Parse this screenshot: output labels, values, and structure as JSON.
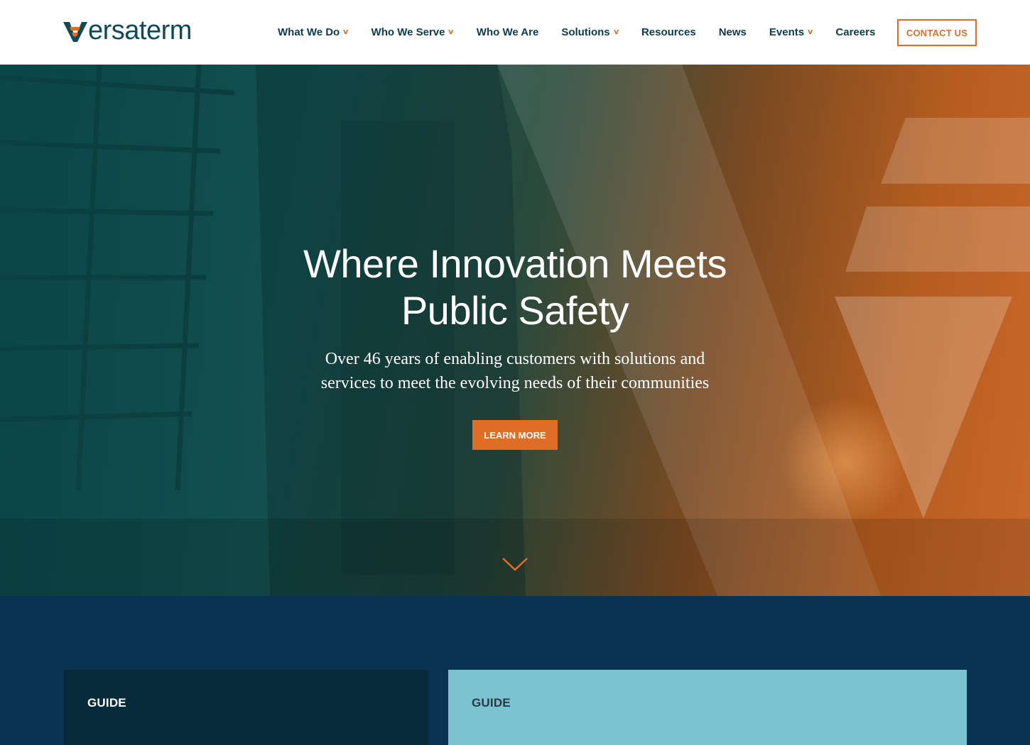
{
  "brand": {
    "name": "versaterm",
    "logo_text": "ersaterm",
    "primary_color": "#0c4a5a",
    "accent_color": "#e06d26"
  },
  "nav": {
    "items": [
      {
        "label": "What We Do",
        "has_dropdown": true
      },
      {
        "label": "Who We Serve",
        "has_dropdown": true
      },
      {
        "label": "Who We Are",
        "has_dropdown": false
      },
      {
        "label": "Solutions",
        "has_dropdown": true
      },
      {
        "label": "Resources",
        "has_dropdown": false
      },
      {
        "label": "News",
        "has_dropdown": false
      },
      {
        "label": "Events",
        "has_dropdown": true
      },
      {
        "label": "Careers",
        "has_dropdown": false
      }
    ],
    "dropdown_icon": "chevron-down-icon",
    "contact_label": "CONTACT US"
  },
  "hero": {
    "title_line1": "Where Innovation Meets",
    "title_line2": "Public Safety",
    "subtitle_line1": "Over 46 years of enabling customers with solutions and",
    "subtitle_line2": "services to meet the evolving needs of their communities",
    "cta_label": "LEARN MORE",
    "scroll_icon": "chevron-down-icon"
  },
  "cards": [
    {
      "label": "GUIDE",
      "background": "#072b3a"
    },
    {
      "label": "GUIDE",
      "background": "#7bc3d0"
    }
  ]
}
